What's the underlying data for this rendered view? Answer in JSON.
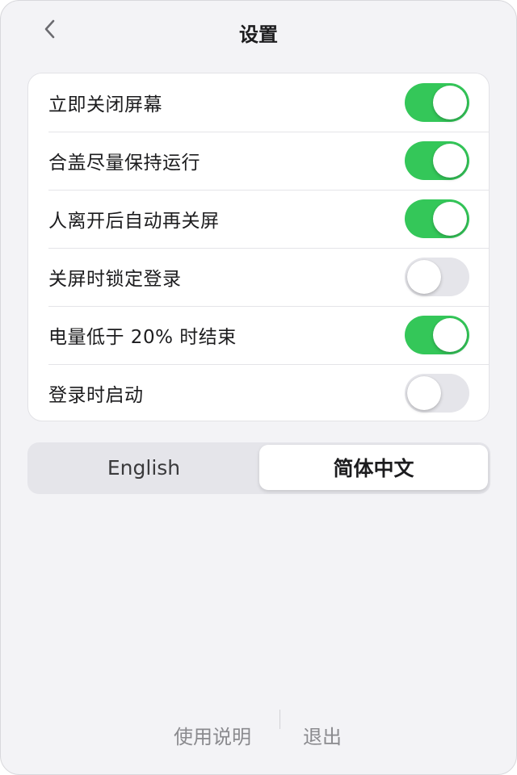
{
  "header": {
    "title": "设置",
    "back_icon": "chevron-left-icon"
  },
  "settings": [
    {
      "label": "立即关闭屏幕",
      "enabled": true
    },
    {
      "label": "合盖尽量保持运行",
      "enabled": true
    },
    {
      "label": "人离开后自动再关屏",
      "enabled": true
    },
    {
      "label": "关屏时锁定登录",
      "enabled": false
    },
    {
      "label": "电量低于 20% 时结束",
      "enabled": true
    },
    {
      "label": "登录时启动",
      "enabled": false
    }
  ],
  "language": {
    "options": [
      "English",
      "简体中文"
    ],
    "selected": "简体中文"
  },
  "footer": {
    "help_label": "使用说明",
    "quit_label": "退出"
  },
  "colors": {
    "toggle_on": "#34c759",
    "toggle_off": "#e5e5ea",
    "background": "#f3f3f6"
  }
}
